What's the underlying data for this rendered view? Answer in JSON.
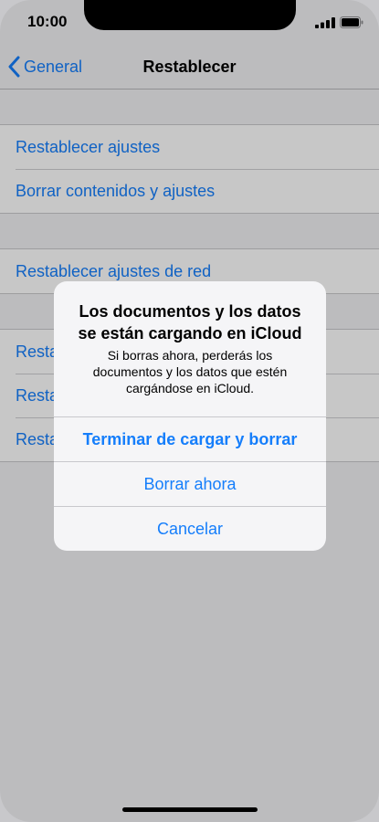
{
  "status_bar": {
    "time": "10:00"
  },
  "nav": {
    "back_label": "General",
    "title": "Restablecer"
  },
  "list": {
    "group1": [
      "Restablecer ajustes",
      "Borrar contenidos y ajustes"
    ],
    "group2": [
      "Restablecer ajustes de red"
    ],
    "group3": [
      "Resta",
      "Resta",
      "Resta"
    ]
  },
  "alert": {
    "title_line1": "Los documentos y los datos",
    "title_line2": "se están cargando en iCloud",
    "message_line1": "Si borras ahora, perderás los",
    "message_line2": "documentos y los datos que estén",
    "message_line3": "cargándose en iCloud.",
    "buttons": [
      "Terminar de cargar y borrar",
      "Borrar ahora",
      "Cancelar"
    ]
  },
  "colors": {
    "accent": "#157efb",
    "background": "#f1f1f4"
  },
  "icons": {
    "back": "chevron-left-icon",
    "signal": "cellular-signal-icon",
    "battery": "battery-icon"
  }
}
